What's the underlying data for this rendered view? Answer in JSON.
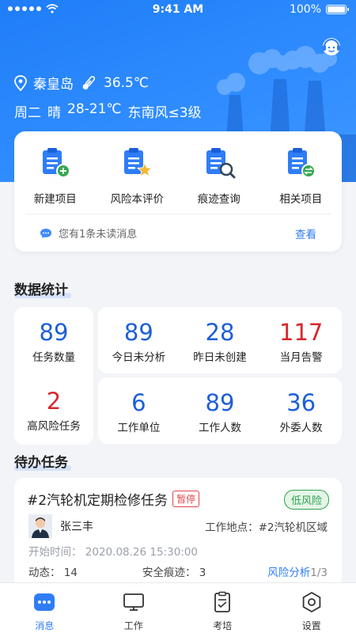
{
  "status": {
    "time": "9:41 AM",
    "battery": "100%"
  },
  "location": {
    "city": "秦皇岛",
    "temperature": "36.5℃"
  },
  "weather": {
    "day": "周二",
    "condition": "晴",
    "range": "28-21℃",
    "wind": "东南风≤3级"
  },
  "quick_actions": [
    {
      "label": "新建项目",
      "icon": "doc-plus-icon"
    },
    {
      "label": "风险本评价",
      "icon": "doc-star-icon"
    },
    {
      "label": "痕迹查询",
      "icon": "doc-search-icon"
    },
    {
      "label": "相关项目",
      "icon": "doc-link-icon"
    }
  ],
  "notice": {
    "text": "您有1条未读消息",
    "action": "查看"
  },
  "stats_section": {
    "title": "数据统计"
  },
  "stats": [
    {
      "value": "89",
      "label": "任务数量",
      "color": "blue"
    },
    {
      "value": "2",
      "label": "高风险任务",
      "color": "red"
    },
    {
      "value": "89",
      "label": "今日未分析",
      "color": "blue"
    },
    {
      "value": "28",
      "label": "昨日未创建",
      "color": "blue"
    },
    {
      "value": "117",
      "label": "当月告警",
      "color": "red"
    },
    {
      "value": "6",
      "label": "工作单位",
      "color": "blue"
    },
    {
      "value": "89",
      "label": "工作人数",
      "color": "blue"
    },
    {
      "value": "36",
      "label": "外委人数",
      "color": "blue"
    }
  ],
  "todo_section": {
    "title": "待办任务"
  },
  "task": {
    "title": "#2汽轮机定期检修任务",
    "status_tag": "暂停",
    "risk_tag": "低风险",
    "person": "张三丰",
    "location": "工作地点：#2汽轮机区域",
    "start": "开始时间：  2020.08.26   15:30:00",
    "dynamic_label": "动态：",
    "dynamic_value": "14",
    "trace_label": "安全痕迹：",
    "trace_value": "3",
    "analysis_link": "风险分析",
    "pages": "1/3"
  },
  "tabs": [
    {
      "label": "消息",
      "icon": "message-icon",
      "active": true
    },
    {
      "label": "工作",
      "icon": "monitor-icon",
      "active": false
    },
    {
      "label": "考培",
      "icon": "clipboard-icon",
      "active": false
    },
    {
      "label": "设置",
      "icon": "settings-icon",
      "active": false
    }
  ],
  "colors": {
    "primary": "#2f7df6",
    "stat_blue": "#1d5fd8",
    "stat_red": "#d7262d",
    "risk_green": "#2ea44f",
    "pause_red": "#e2454a"
  }
}
